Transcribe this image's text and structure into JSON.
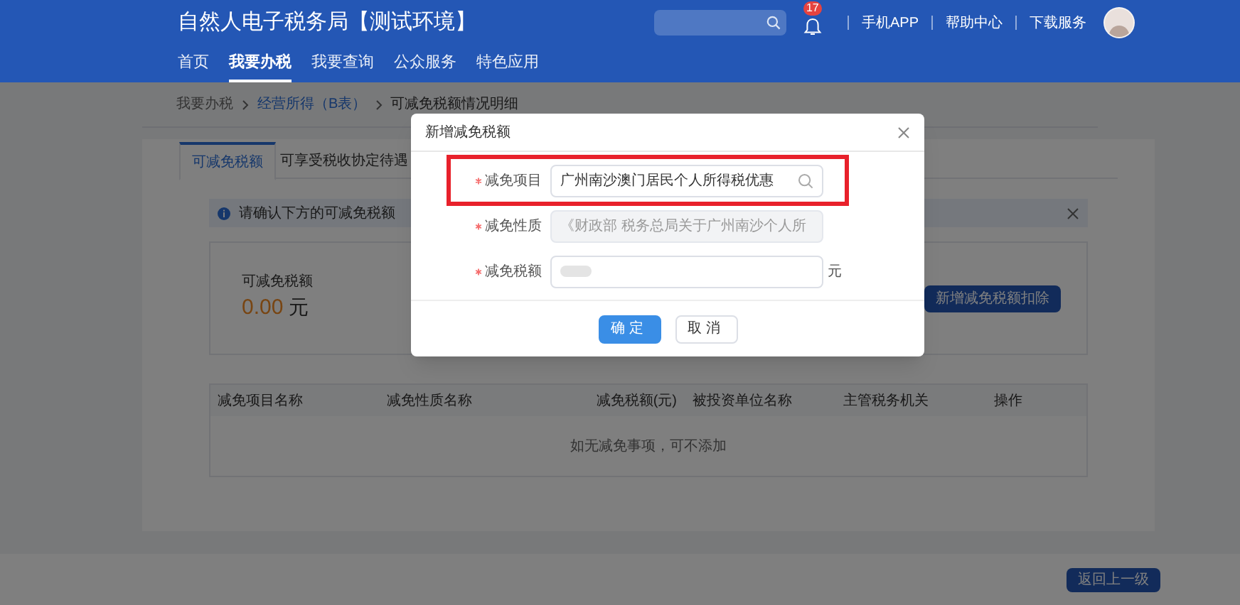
{
  "header": {
    "title": "自然人电子税务局【测试环境】",
    "notification_count": "17",
    "links": [
      "手机APP",
      "帮助中心",
      "下载服务"
    ]
  },
  "nav": [
    {
      "label": "首页",
      "selected": false
    },
    {
      "label": "我要办税",
      "selected": true
    },
    {
      "label": "我要查询",
      "selected": false
    },
    {
      "label": "公众服务",
      "selected": false
    },
    {
      "label": "特色应用",
      "selected": false
    }
  ],
  "breadcrumb": [
    {
      "label": "我要办税",
      "kind": "plain"
    },
    {
      "label": "经营所得（B表）",
      "kind": "link"
    },
    {
      "label": "可减免税额情况明细",
      "kind": "current"
    }
  ],
  "tabs": [
    {
      "label": "可减免税额",
      "selected": true
    },
    {
      "label": "可享受税收协定待遇",
      "selected": false
    }
  ],
  "info": {
    "text": "请确认下方的可减免税额"
  },
  "summary": {
    "label": "可减免税额",
    "amount": "0.00",
    "unit": "元"
  },
  "add_button": "新增减免税额扣除",
  "table": {
    "columns": [
      "减免项目名称",
      "减免性质名称",
      "减免税额(元)",
      "被投资单位名称",
      "主管税务机关",
      "操作"
    ],
    "empty_text": "如无减免事项，可不添加"
  },
  "footer_button": "返回上一级",
  "dialog": {
    "title": "新增减免税额",
    "fields": [
      {
        "label": "减免项目",
        "required": true,
        "kind": "search",
        "value": "广州南沙澳门居民个人所得税优惠",
        "disabled": false,
        "highlighted": true
      },
      {
        "label": "减免性质",
        "required": true,
        "kind": "text",
        "value": "《财政部 税务总局关于广州南沙个人所",
        "disabled": true,
        "highlighted": false
      },
      {
        "label": "减免税额",
        "required": true,
        "kind": "amount",
        "redacted": true,
        "unit": "元",
        "disabled": false,
        "highlighted": false
      }
    ],
    "buttons": [
      {
        "label": "确定",
        "kind": "primary"
      },
      {
        "label": "取消",
        "kind": "default"
      }
    ]
  }
}
